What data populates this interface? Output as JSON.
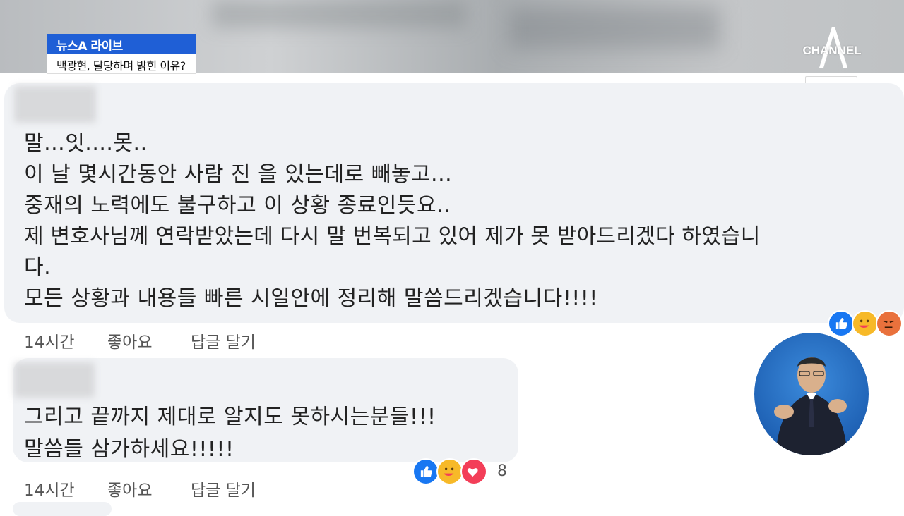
{
  "broadcast": {
    "program": "뉴스A 라이브",
    "headline": "백광현, 탈당하며 밝힌 이유?",
    "channel_logo": "CHANNEL"
  },
  "comments": [
    {
      "lines": [
        "말...잇....못..",
        "이 날 몇시간동안 사람 진 을 있는데로 빼놓고...",
        "중재의 노력에도 불구하고 이 상황 종료인듯요..",
        "제 변호사님께 연락받았는데 다시 말 번복되고 있어 제가 못 받아드리겠다 하였습니",
        "다.",
        "모든 상황과 내용들 빠른 시일안에 정리해 말씀드리겠습니다!!!!"
      ],
      "time": "14시간",
      "like": "좋아요",
      "reply": "답글 달기",
      "reactions": [
        "like-icon",
        "care-icon",
        "angry-icon"
      ]
    },
    {
      "lines": [
        "그리고 끝까지 제대로 알지도 못하시는분들!!!",
        "말씀들 삼가하세요!!!!!"
      ],
      "time": "14시간",
      "like": "좋아요",
      "reply": "답글 달기",
      "reactions": [
        "like-icon",
        "care-icon",
        "love-icon"
      ],
      "reaction_count": "8"
    }
  ],
  "colors": {
    "news_tag_blue": "#1f5fd6",
    "bubble_bg": "#f0f2f5",
    "like_blue": "#1877f2",
    "care_yellow": "#f7b928",
    "love_red": "#f33e58",
    "angry_orange": "#e9713c"
  }
}
